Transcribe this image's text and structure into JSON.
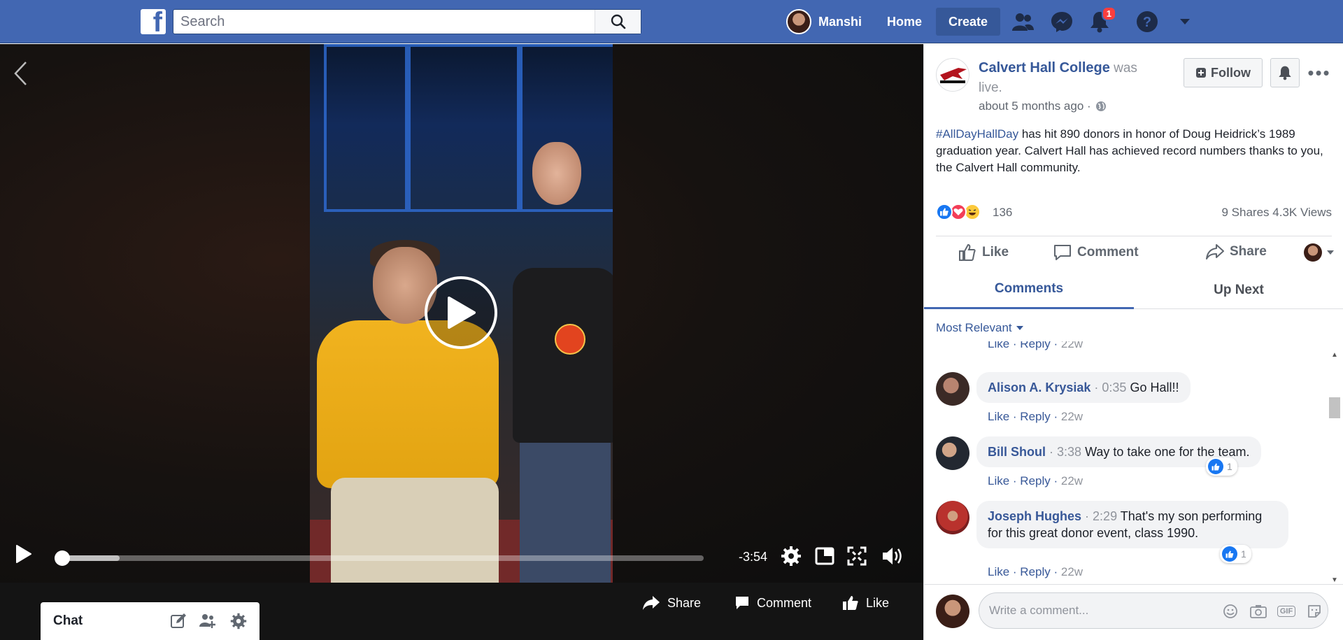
{
  "topbar": {
    "logo_letter": "f",
    "search_placeholder": "Search",
    "profile_name": "Manshi",
    "home_label": "Home",
    "create_label": "Create",
    "notifications_count": "1",
    "bg_color": "#4267b2"
  },
  "player": {
    "time_remaining": "-3:54",
    "progress_fraction": 0,
    "buffered_fraction": 0.1
  },
  "video_actions": {
    "share_label": "Share",
    "comment_label": "Comment",
    "like_label": "Like"
  },
  "chat": {
    "label": "Chat"
  },
  "post": {
    "page_name": "Calvert Hall College",
    "status_suffix": "was live.",
    "timestamp": "about 5 months ago ·",
    "follow_label": "Follow",
    "text_hashtag": "#AllDayHallDay",
    "text_body": " has hit 890 donors in honor of Doug Heidrick’s 1989 graduation year. Calvert Hall has achieved record numbers thanks to you, the Calvert Hall community.",
    "reaction_count": "136",
    "shares_views": "9 Shares  4.3K Views",
    "like_label": "Like",
    "comment_label": "Comment",
    "share_label": "Share"
  },
  "tabs": {
    "comments": "Comments",
    "up_next": "Up Next"
  },
  "sort_label": "Most Relevant",
  "comments": [
    {
      "name": "",
      "stamp": "",
      "text": "",
      "meta_like": "Like",
      "meta_reply": "Reply",
      "meta_age": "22w"
    },
    {
      "name": "Alison A. Krysiak",
      "stamp": "0:35",
      "text": "Go Hall!!",
      "meta_like": "Like",
      "meta_reply": "Reply",
      "meta_age": "22w"
    },
    {
      "name": "Bill Shoul",
      "stamp": "3:38",
      "text": "Way to take one for the team.",
      "likes": "1",
      "meta_like": "Like",
      "meta_reply": "Reply",
      "meta_age": "22w"
    },
    {
      "name": "Joseph Hughes",
      "stamp": "2:29",
      "text": "That's my son performing for this great donor event, class 1990.",
      "likes": "1",
      "meta_like": "Like",
      "meta_reply": "Reply",
      "meta_age": "22w"
    }
  ],
  "write_comment": {
    "placeholder": "Write a comment...",
    "gif_label": "GIF"
  }
}
